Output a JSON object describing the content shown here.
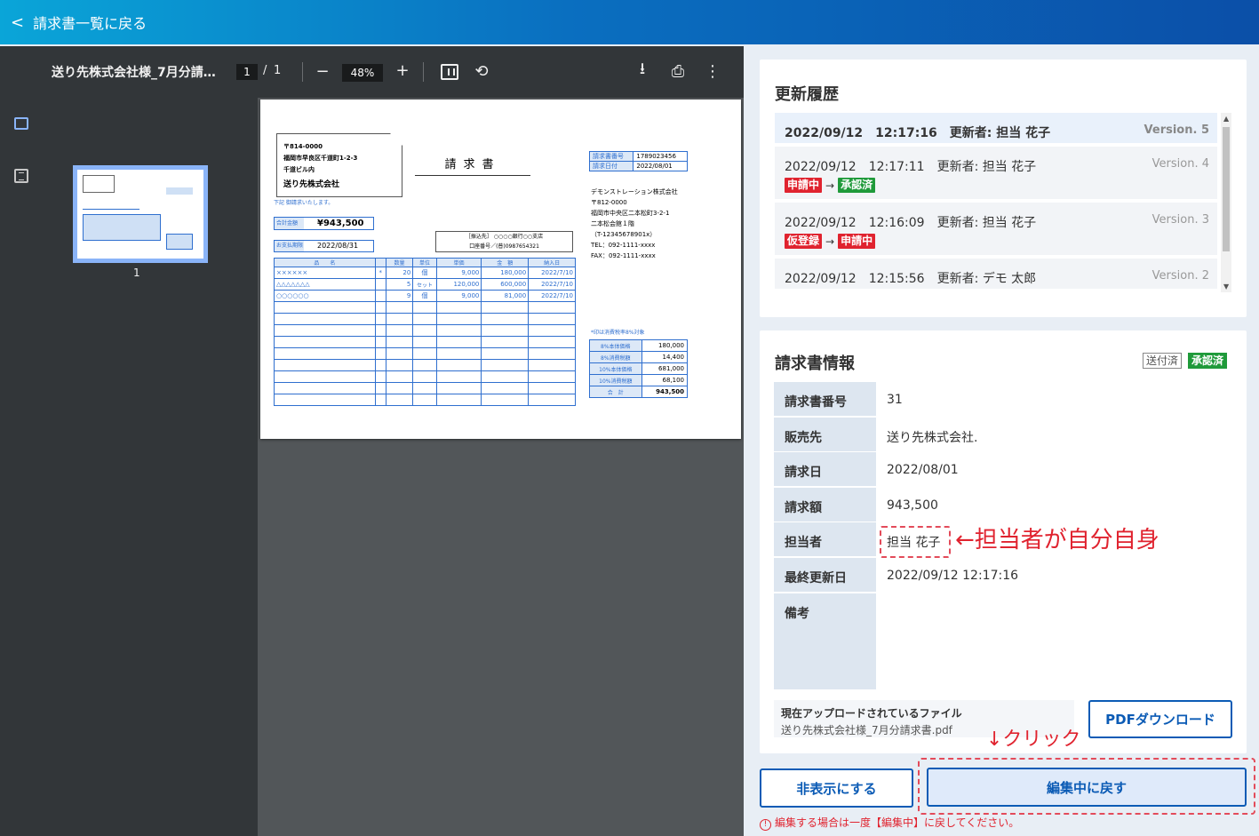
{
  "topbar": {
    "back_label": "請求書一覧に戻る"
  },
  "viewer": {
    "doc_title": "送り先株式会社様_7月分請…",
    "page_current": "1",
    "page_sep": "/",
    "page_total": "1",
    "zoom": "48%",
    "zoom_out": "−",
    "zoom_in": "+",
    "thumb_label": "1"
  },
  "paper": {
    "postal": "〒814-0000",
    "addr1": "福岡市早良区千道町1-2-3",
    "addr2": "千道ビル内",
    "recipient": "送り先株式会社",
    "doc_title": "請求書",
    "invoice_no_label": "請求書番号",
    "invoice_no": "1789023456",
    "invoice_date_label": "請求日付",
    "invoice_date": "2022/08/01",
    "greeting": "下記 御請求いたします。",
    "total_label": "合計金額",
    "total": "¥943,500",
    "due_label": "お支払期限",
    "due": "2022/08/31",
    "bank1": "［振込先］ ○○○○銀行○○支店",
    "bank2": "口座番号／(普)0987654321",
    "sender": [
      "デモンストレーション株式会社",
      "〒812-0000",
      "福岡市中央区二本松町3-2-1",
      "二本松会館１階",
      "（T-12345678901x）",
      "TEL：092-1111-xxxx",
      "FAX：092-1111-xxxx"
    ],
    "items_headers": [
      "品　　名",
      "",
      "数量",
      "単位",
      "単価",
      "金　額",
      "納入日"
    ],
    "items": [
      [
        "××××××",
        "*",
        "20",
        "個",
        "9,000",
        "180,000",
        "2022/7/10"
      ],
      [
        "△△△△△△△",
        "",
        "5",
        "セット",
        "120,000",
        "600,000",
        "2022/7/10"
      ],
      [
        "○○○○○○",
        "",
        "9",
        "個",
        "9,000",
        "81,000",
        "2022/7/10"
      ]
    ],
    "tax_note": "*印は消費税率8%対象",
    "summary": [
      {
        "label": "8%本体価格",
        "value": "180,000"
      },
      {
        "label": "8%消費税額",
        "value": "14,400"
      },
      {
        "label": "10%本体価格",
        "value": "681,000"
      },
      {
        "label": "10%消費税額",
        "value": "68,100"
      },
      {
        "label": "合　計",
        "value": "943,500"
      }
    ]
  },
  "history": {
    "title": "更新履歴",
    "items": [
      {
        "meta": "2022/09/12　12:17:16　更新者: 担当 花子",
        "version": "Version. 5"
      },
      {
        "meta": "2022/09/12　12:17:11　更新者: 担当 花子",
        "version": "Version. 4",
        "from": "申請中",
        "to": "承認済",
        "arrow": "→"
      },
      {
        "meta": "2022/09/12　12:16:09　更新者: 担当 花子",
        "version": "Version. 3",
        "from": "仮登録",
        "to": "申請中",
        "arrow": "→"
      },
      {
        "meta": "2022/09/12　12:15:56　更新者: デモ 太郎",
        "version": "Version. 2"
      }
    ],
    "scroll_up": "▲",
    "scroll_down": "▼"
  },
  "info": {
    "title": "請求書情報",
    "tag_sent": "送付済",
    "tag_ok": "承認済",
    "rows": [
      {
        "label": "請求書番号",
        "value": "31"
      },
      {
        "label": "販売先",
        "value": "送り先株式会社."
      },
      {
        "label": "請求日",
        "value": "2022/08/01"
      },
      {
        "label": "請求額",
        "value": "943,500"
      },
      {
        "label": "担当者",
        "value": "担当 花子"
      },
      {
        "label": "最終更新日",
        "value": "2022/09/12 12:17:16"
      },
      {
        "label": "備考",
        "value": ""
      }
    ],
    "file_label": "現在アップロードされているファイル",
    "file_name": "送り先株式会社様_7月分請求書.pdf",
    "pdf_button": "PDFダウンロード"
  },
  "annotations": {
    "assignee_note": "←担当者が自分自身",
    "click_note": "↓クリック"
  },
  "actions": {
    "hide_button": "非表示にする",
    "edit_button": "編集中に戻す",
    "warning_icon": "!",
    "warning": "編集する場合は一度【編集中】に戻してください。"
  },
  "colors": {
    "accent": "#0b5bb5",
    "danger": "#e0232f",
    "approved": "#1f9a3a"
  }
}
